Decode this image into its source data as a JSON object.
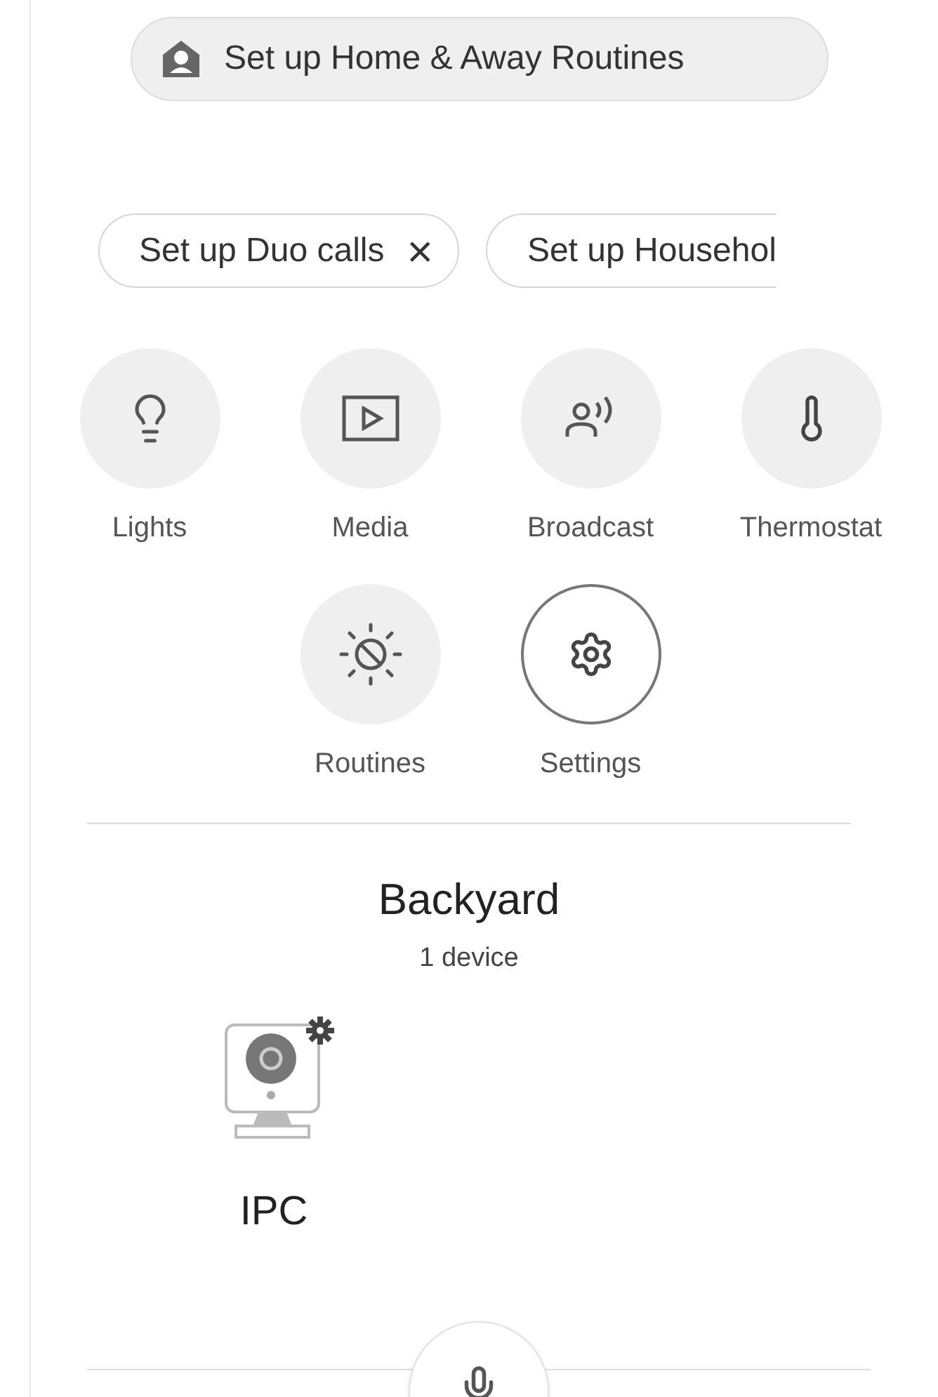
{
  "home_chip": {
    "label": "Set up Home & Away Routines"
  },
  "chips": [
    {
      "label": "Set up Duo calls",
      "close": "×"
    },
    {
      "label": "Set up Househol"
    }
  ],
  "actions": [
    {
      "label": "Lights",
      "kind": "filled"
    },
    {
      "label": "Media",
      "kind": "filled"
    },
    {
      "label": "Broadcast",
      "kind": "filled"
    },
    {
      "label": "Thermostat",
      "kind": "filled"
    },
    {
      "label": "Routines",
      "kind": "filled"
    },
    {
      "label": "Settings",
      "kind": "outlined"
    }
  ],
  "room": {
    "title": "Backyard",
    "count": "1 device",
    "devices": [
      {
        "name": "IPC"
      }
    ]
  }
}
